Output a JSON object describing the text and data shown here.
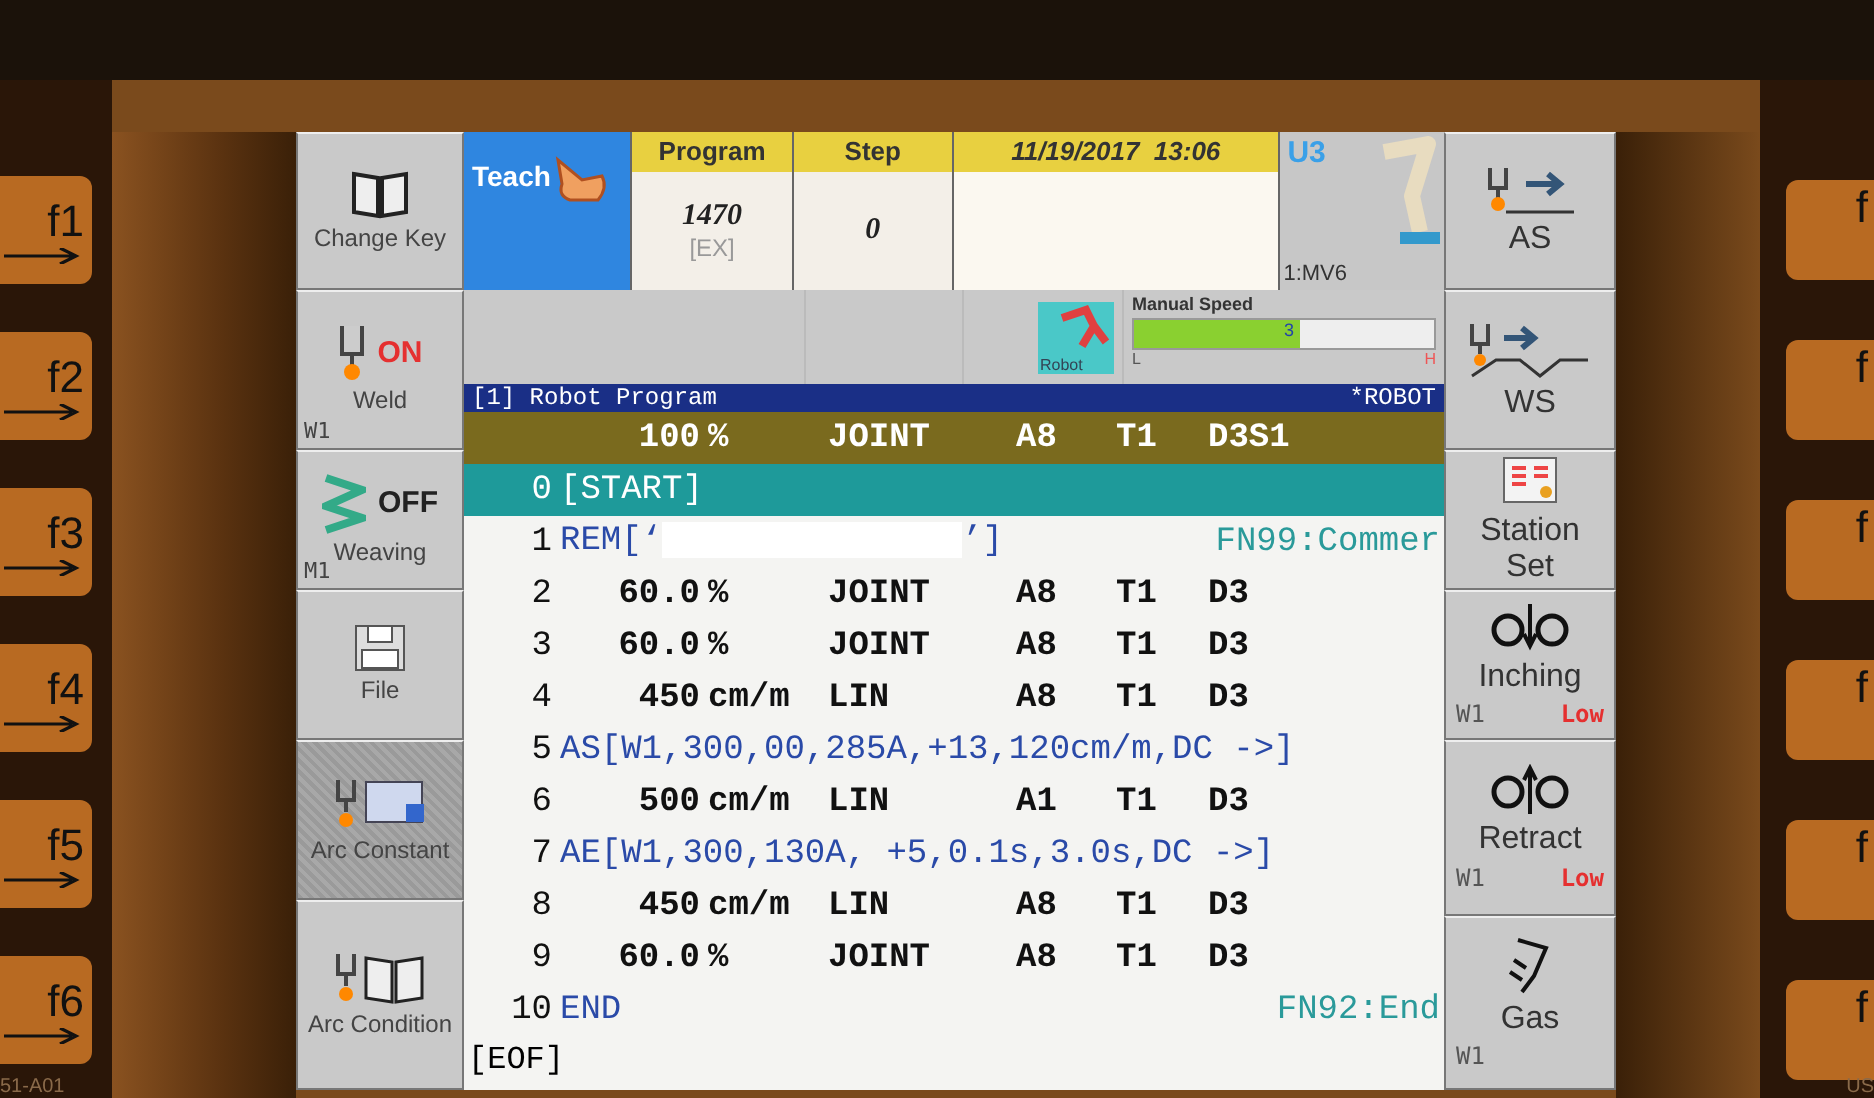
{
  "keys_left": [
    "f1",
    "f2",
    "f3",
    "f4",
    "f5",
    "f6"
  ],
  "keys_right": [
    "f",
    "f",
    "f",
    "f",
    "f",
    "f"
  ],
  "panel_code": "51-A01",
  "corner_text": "US",
  "left_menu": [
    {
      "label": "Change Key",
      "active": false
    },
    {
      "label": "Weld",
      "status": "ON",
      "on": true,
      "channel": "W1",
      "active": false
    },
    {
      "label": "Weaving",
      "status": "OFF",
      "on": false,
      "channel": "M1",
      "active": false
    },
    {
      "label": "File",
      "active": false
    },
    {
      "label": "Arc Constant",
      "active": true
    },
    {
      "label": "Arc Condition",
      "active": false
    }
  ],
  "top": {
    "mode": "Teach",
    "program": {
      "heading": "Program",
      "value": "1470",
      "sub": "[EX]"
    },
    "step": {
      "heading": "Step",
      "value": "0"
    },
    "date": "11/19/2017",
    "time": "13:06",
    "group": "U3",
    "model": "1:MV6"
  },
  "status_row": {
    "robot_label": "Robot",
    "manual_speed": {
      "title": "Manual Speed",
      "value": "3",
      "level": 0.55,
      "low": "L",
      "high": "H"
    }
  },
  "program": {
    "title": "[1] Robot Program",
    "unit": "*ROBOT",
    "header": [
      "100",
      "%",
      "JOINT",
      "A8",
      "T1",
      "D3S1"
    ],
    "rows": [
      {
        "line": "0",
        "kind": "marker",
        "text": "[START]",
        "selected": true
      },
      {
        "line": "1",
        "kind": "comment",
        "text": "REM[‘",
        "tail": "’]",
        "note": "FN99:Commer",
        "selected": false
      },
      {
        "line": "2",
        "kind": "move",
        "fields": [
          "60.0",
          "%",
          "JOINT",
          "A8",
          "T1",
          "D3"
        ],
        "selected": false
      },
      {
        "line": "3",
        "kind": "move",
        "fields": [
          "60.0",
          "%",
          "JOINT",
          "A8",
          "T1",
          "D3"
        ],
        "selected": false
      },
      {
        "line": "4",
        "kind": "move",
        "fields": [
          "450",
          "cm/m",
          "LIN",
          "A8",
          "T1",
          "D3"
        ],
        "selected": false
      },
      {
        "line": "5",
        "kind": "instruction",
        "text": "AS[W1,300,00,285A,+13,120cm/m,DC ->]",
        "selected": false
      },
      {
        "line": "6",
        "kind": "move",
        "fields": [
          "500",
          "cm/m",
          "LIN",
          "A1",
          "T1",
          "D3"
        ],
        "selected": false
      },
      {
        "line": "7",
        "kind": "instruction",
        "text": "AE[W1,300,130A, +5,0.1s,3.0s,DC ->]",
        "selected": false
      },
      {
        "line": "8",
        "kind": "move",
        "fields": [
          "450",
          "cm/m",
          "LIN",
          "A8",
          "T1",
          "D3"
        ],
        "selected": false
      },
      {
        "line": "9",
        "kind": "move",
        "fields": [
          "60.0",
          "%",
          "JOINT",
          "A8",
          "T1",
          "D3"
        ],
        "selected": false
      },
      {
        "line": "10",
        "kind": "instruction",
        "text": "END",
        "note": "FN92:End",
        "selected": false
      }
    ],
    "eof": "[EOF]"
  },
  "right_menu": [
    {
      "label": "AS"
    },
    {
      "label": "WS"
    },
    {
      "label": "Station Set"
    },
    {
      "label": "Inching",
      "channel": "W1",
      "speed": "Low"
    },
    {
      "label": "Retract",
      "channel": "W1",
      "speed": "Low"
    },
    {
      "label": "Gas",
      "channel": "W1"
    }
  ]
}
